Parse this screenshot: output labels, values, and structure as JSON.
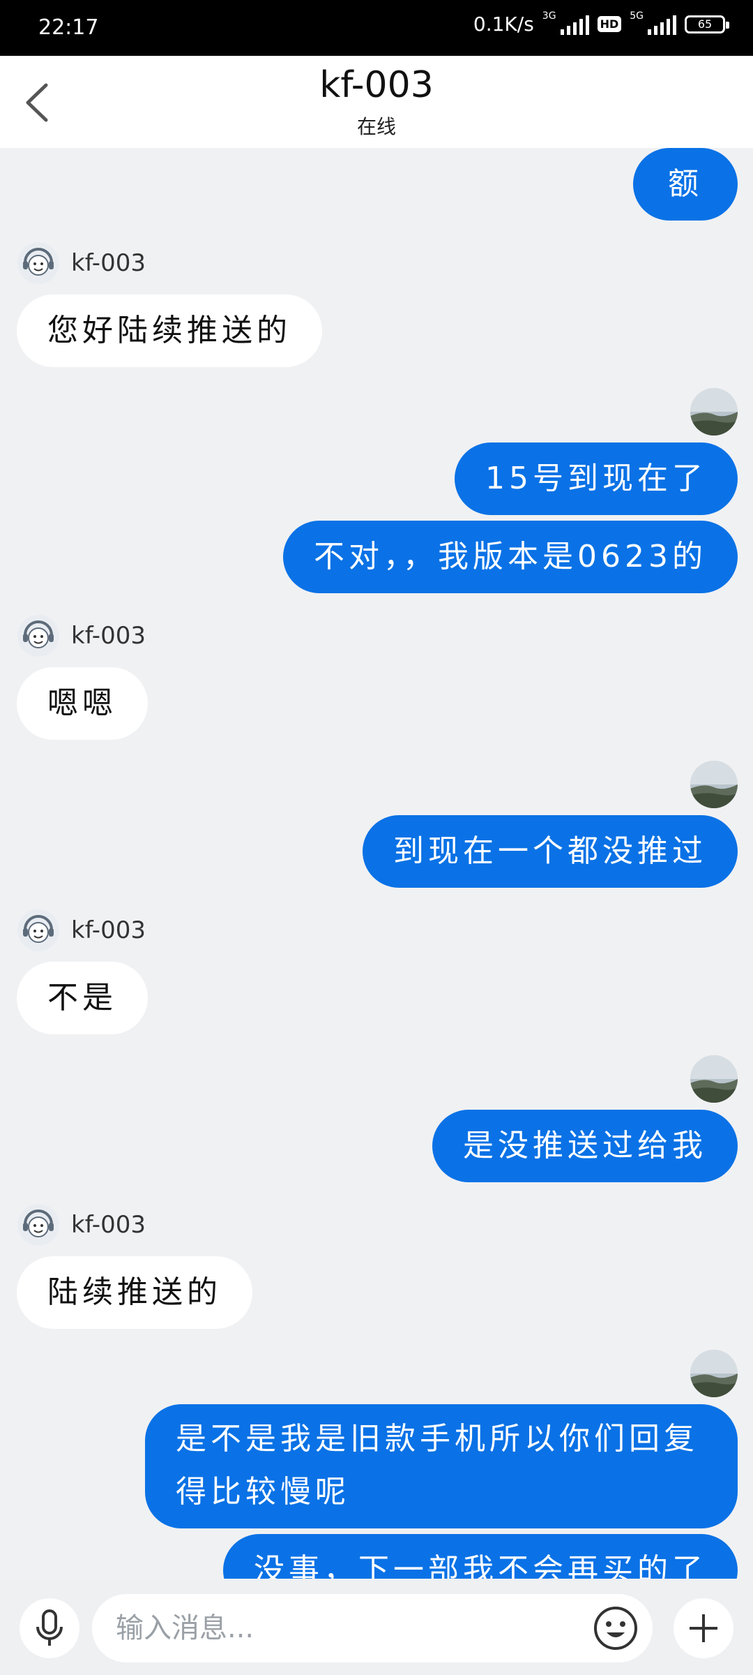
{
  "status_bar": {
    "time": "22:17",
    "net_speed": "0.1K/s",
    "net_type_1": "3G",
    "hd": "HD",
    "net_type_2": "5G",
    "battery": "65"
  },
  "header": {
    "title": "kf-003",
    "status": "在线"
  },
  "agent_name": "kf-003",
  "messages": [
    {
      "from": "me",
      "text": "额"
    },
    {
      "from": "agent",
      "text": "您好陆续推送的"
    },
    {
      "from": "me",
      "text": "15号到现在了"
    },
    {
      "from": "me",
      "text": "不对，，我版本是0623的"
    },
    {
      "from": "agent",
      "text": "嗯嗯"
    },
    {
      "from": "me",
      "text": "到现在一个都没推过"
    },
    {
      "from": "agent",
      "text": "不是"
    },
    {
      "from": "me",
      "text": "是没推送过给我"
    },
    {
      "from": "agent",
      "text": "陆续推送的"
    },
    {
      "from": "me",
      "text": "是不是我是旧款手机所以你们回复得比较慢呢"
    },
    {
      "from": "me",
      "text": "没事，下一部我不会再买的了"
    }
  ],
  "input": {
    "placeholder": "输入消息..."
  },
  "colors": {
    "my_bubble": "#0a72e6",
    "agent_bubble": "#ffffff",
    "background": "#f0f1f3"
  }
}
